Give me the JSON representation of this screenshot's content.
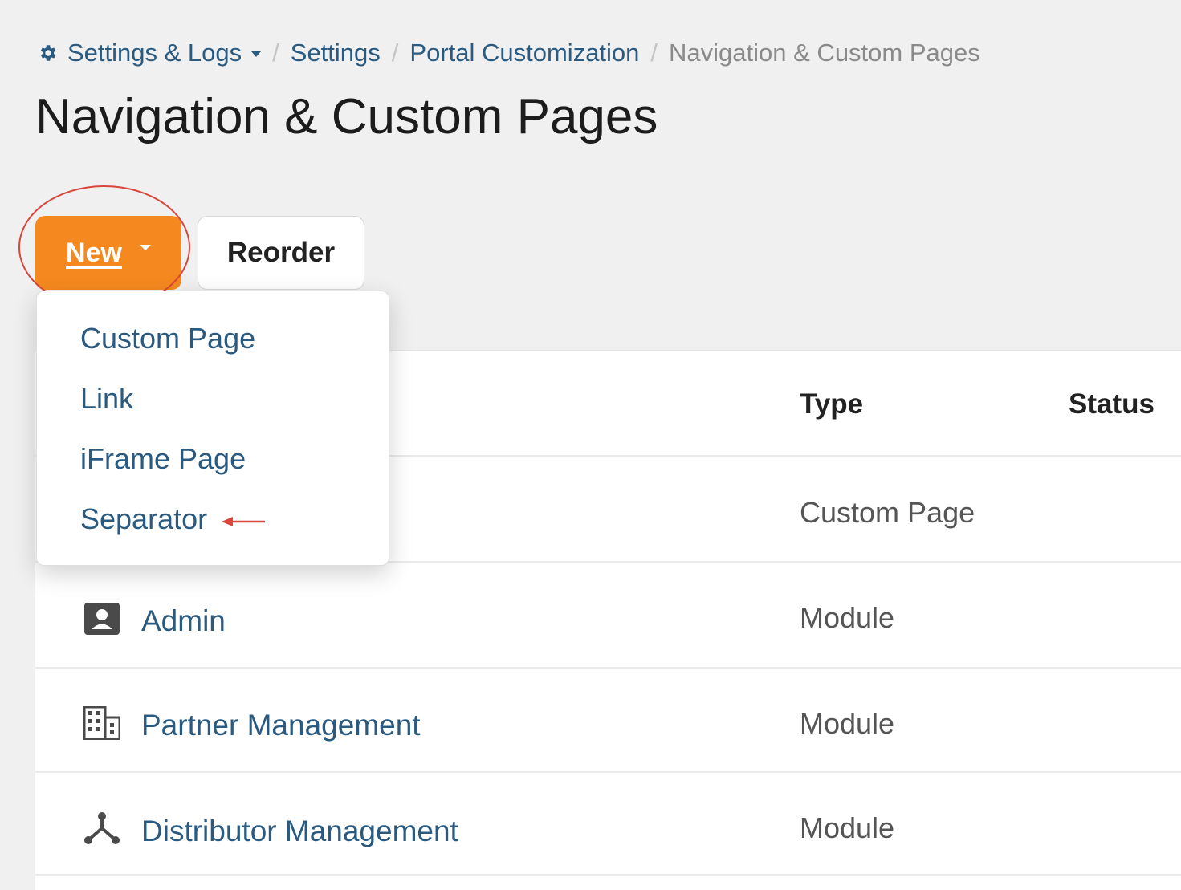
{
  "breadcrumb": {
    "items": [
      "Settings & Logs",
      "Settings",
      "Portal Customization"
    ],
    "current": "Navigation & Custom Pages",
    "separator": "/",
    "icon": "gear-icon"
  },
  "page": {
    "title": "Navigation & Custom Pages"
  },
  "toolbar": {
    "new_label": "New",
    "reorder_label": "Reorder"
  },
  "dropdown": {
    "items": [
      "Custom Page",
      "Link",
      "iFrame Page",
      "Separator"
    ]
  },
  "table": {
    "columns": {
      "type": "Type",
      "status": "Status"
    },
    "rows": [
      {
        "name": "",
        "type": "Custom Page",
        "icon": ""
      },
      {
        "name": "Admin",
        "type": "Module",
        "icon": "contact-card-icon"
      },
      {
        "name": "Partner Management",
        "type": "Module",
        "icon": "building-icon"
      },
      {
        "name": "Distributor Management",
        "type": "Module",
        "icon": "hub-icon"
      }
    ]
  },
  "colors": {
    "accent": "#f5891f",
    "link": "#2a5a80",
    "annotation": "#d9463a"
  }
}
